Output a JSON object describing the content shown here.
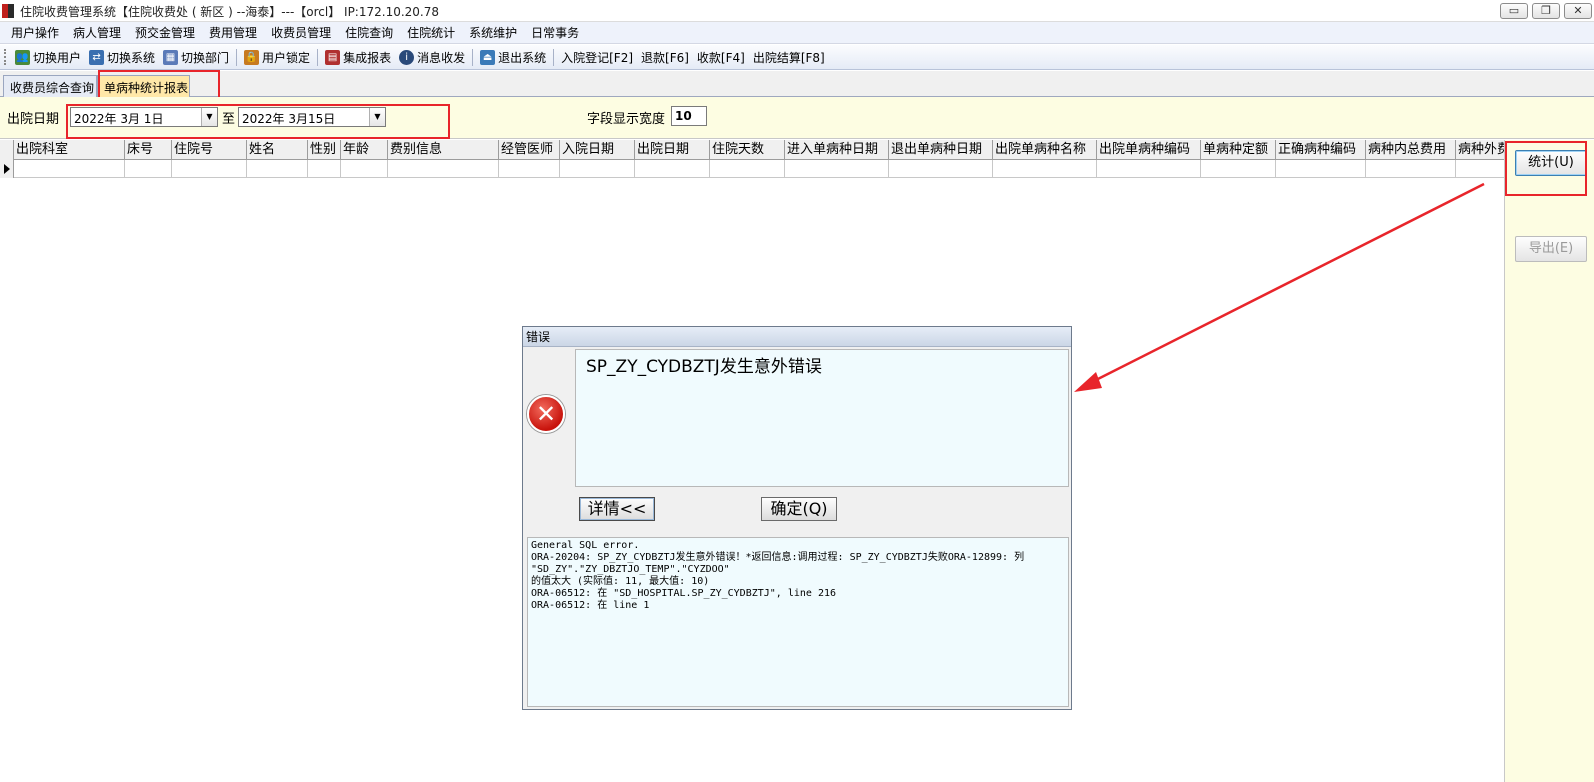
{
  "window": {
    "title": "住院收费管理系统【住院收费处 ( 新区 ) --海泰】---【orcl】 IP:172.10.20.78",
    "minimize_glyph": "▭",
    "restore_glyph": "❐",
    "close_glyph": "✕"
  },
  "menubar": {
    "items": [
      "用户操作",
      "病人管理",
      "预交金管理",
      "费用管理",
      "收费员管理",
      "住院查询",
      "住院统计",
      "系统维护",
      "日常事务"
    ]
  },
  "toolbar": {
    "items": [
      {
        "label": "切换用户",
        "icon": "users-icon",
        "color": "#4a8a3a"
      },
      {
        "label": "切换系统",
        "icon": "system-switch-icon",
        "color": "#3a6fb0"
      },
      {
        "label": "切换部门",
        "icon": "department-icon",
        "color": "#5a7ab8"
      },
      {
        "label": "用户锁定",
        "icon": "lock-user-icon",
        "color": "#c77a20"
      },
      {
        "label": "集成报表",
        "icon": "report-icon",
        "color": "#b03030"
      },
      {
        "label": "消息收发",
        "icon": "info-icon",
        "color": "#2a4a7a"
      },
      {
        "label": "退出系统",
        "icon": "exit-icon",
        "color": "#3a7ab8"
      },
      {
        "label": "入院登记[F2]"
      },
      {
        "label": "退款[F6]"
      },
      {
        "label": "收款[F4]"
      },
      {
        "label": "出院结算[F8]"
      }
    ]
  },
  "tabs": [
    {
      "label": "收费员综合查询",
      "active": false
    },
    {
      "label": "单病种统计报表",
      "active": true
    }
  ],
  "filters": {
    "discharge_date_label": "出院日期",
    "date_from": "2022年  3月  1日",
    "range_sep": "至",
    "date_to": "2022年  3月15日",
    "field_width_label": "字段显示宽度",
    "field_width_value": "10"
  },
  "grid": {
    "columns": [
      "出院科室",
      "床号",
      "住院号",
      "姓名",
      "性别",
      "年龄",
      "费别信息",
      "经管医师",
      "入院日期",
      "出院日期",
      "住院天数",
      "进入单病种日期",
      "退出单病种日期",
      "出院单病种名称",
      "出院单病种编码",
      "单病种定额",
      "正确病种编码",
      "病种内总费用",
      "病种外费"
    ]
  },
  "side_buttons": {
    "stat_label": "统计(U)",
    "export_label": "导出(E)"
  },
  "error_dialog": {
    "title": "错误",
    "message": "SP_ZY_CYDBZTJ发生意外错误",
    "detail_button": "详情<<",
    "ok_button": "确定(Q)",
    "details": "General SQL error.\nORA-20204: SP_ZY_CYDBZTJ发生意外错误！*返回信息:调用过程: SP_ZY_CYDBZTJ失败ORA-12899: 列\n\"SD_ZY\".\"ZY_DBZTJO_TEMP\".\"CYZDOO\"\n的值太大 (实际值: 11, 最大值: 10)\nORA-06512: 在 \"SD_HOSPITAL.SP_ZY_CYDBZTJ\", line 216\nORA-06512: 在 line 1"
  },
  "colors": {
    "annotation_red": "#e8252b",
    "panel_yellow": "#fdfde2",
    "active_tab": "#ffe8a8"
  }
}
